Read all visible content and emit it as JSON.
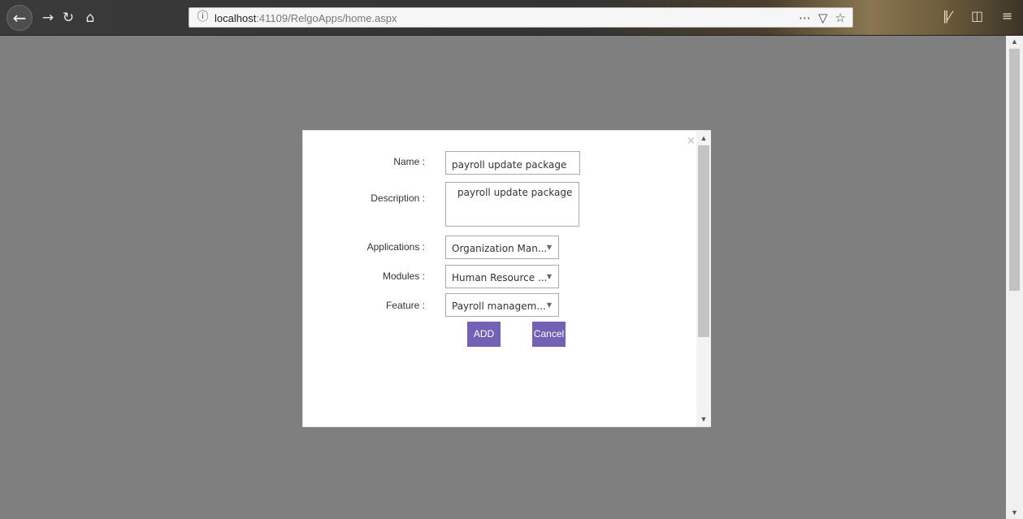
{
  "browser": {
    "url_host": "localhost",
    "url_path": ":41109/RelgoApps/home.aspx",
    "icons": [
      "back-icon",
      "forward-icon",
      "reload-icon",
      "home-icon",
      "info-icon",
      "more-icon",
      "pocket-icon",
      "bookmark-icon",
      "library-icon",
      "sidebar-icon",
      "menu-icon"
    ]
  },
  "modal": {
    "close": "×",
    "form": {
      "name_label": "Name :",
      "name_value": "payroll update package",
      "description_label": "Description :",
      "description_value": "payroll update package",
      "applications_label": "Applications :",
      "applications_value": "Organization Man...",
      "modules_label": "Modules :",
      "modules_value": "Human Resource ...",
      "feature_label": "Feature :",
      "feature_value": "Payroll managem..."
    },
    "buttons": {
      "add": "ADD",
      "cancel": "Cancel"
    }
  }
}
